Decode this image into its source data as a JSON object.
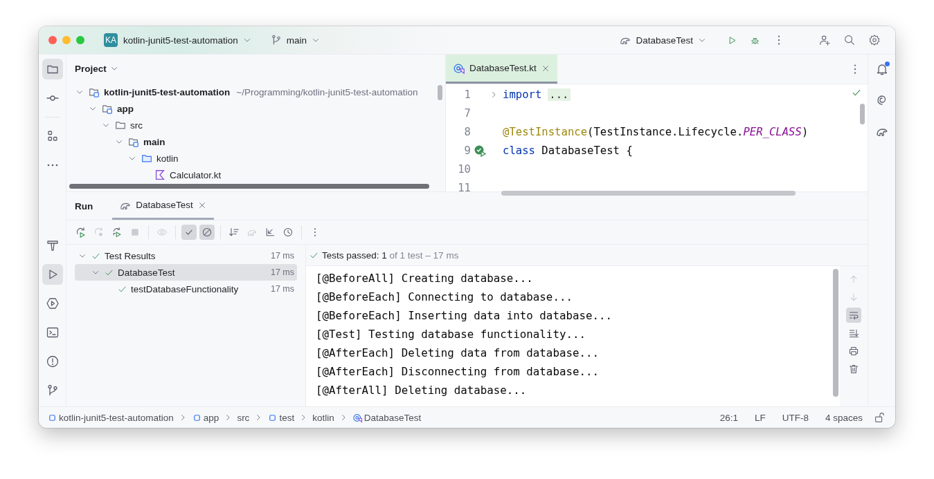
{
  "title_bar": {
    "project_badge": "KA",
    "project": "kotlin-junit5-test-automation",
    "branch": "main",
    "run_config": "DatabaseTest"
  },
  "left_stripe": {
    "top": [
      {
        "kind": "project",
        "selected": true
      },
      {
        "kind": "commit",
        "selected": false
      },
      {
        "kind": "structure",
        "selected": false
      },
      {
        "kind": "more",
        "selected": false
      }
    ],
    "bottom": [
      {
        "kind": "build",
        "selected": false
      },
      {
        "kind": "run",
        "selected": true
      },
      {
        "kind": "services",
        "selected": false
      },
      {
        "kind": "terminal",
        "selected": false
      },
      {
        "kind": "problems",
        "selected": false
      },
      {
        "kind": "git",
        "selected": false
      }
    ]
  },
  "right_stripe": [
    {
      "kind": "notifications",
      "badge": true
    },
    {
      "kind": "assistant",
      "badge": false
    },
    {
      "kind": "gradle",
      "badge": false
    }
  ],
  "project_panel": {
    "title": "Project",
    "tree": [
      {
        "name": "kotlin-junit5-test-automation",
        "kind": "module",
        "bold": true,
        "path": "~/Programming/kotlin-junit5-test-automation",
        "expanded": true,
        "children": [
          {
            "name": "app",
            "kind": "module",
            "bold": true,
            "expanded": true,
            "children": [
              {
                "name": "src",
                "kind": "folder",
                "bold": false,
                "expanded": true,
                "children": [
                  {
                    "name": "main",
                    "kind": "module",
                    "bold": true,
                    "expanded": true,
                    "children": [
                      {
                        "name": "kotlin",
                        "kind": "source_folder",
                        "bold": false,
                        "expanded": true,
                        "children": [
                          {
                            "name": "Calculator.kt",
                            "kind": "kotlin_file",
                            "bold": false
                          }
                        ]
                      }
                    ]
                  }
                ]
              }
            ]
          }
        ]
      }
    ]
  },
  "editor": {
    "tabs": [
      {
        "label": "DatabaseTest.kt",
        "selected": true
      }
    ],
    "lines": [
      {
        "number": "1",
        "folded": true,
        "run_gutter": false,
        "tokens": [
          {
            "text": "import",
            "kind": "keyword"
          },
          {
            "text": "...",
            "kind": "folded"
          }
        ]
      },
      {
        "number": "7",
        "folded": false,
        "run_gutter": false
      },
      {
        "number": "8",
        "folded": false,
        "run_gutter": false,
        "tokens": [
          {
            "text": "@TestInstance",
            "kind": "annotation"
          },
          {
            "text": "(TestInstance.Lifecycle.",
            "kind": "plain"
          },
          {
            "text": "PER_CLASS",
            "kind": "constant"
          },
          {
            "text": ")",
            "kind": "plain"
          }
        ]
      },
      {
        "number": "9",
        "folded": false,
        "run_gutter": true,
        "tokens": [
          {
            "text": "class",
            "kind": "keyword"
          },
          {
            "text": " DatabaseTest {",
            "kind": "plain"
          }
        ]
      },
      {
        "number": "10",
        "folded": false,
        "run_gutter": false
      },
      {
        "number": "11",
        "folded": false,
        "run_gutter": false
      }
    ]
  },
  "run_panel": {
    "title": "Run",
    "tabs": [
      {
        "label": "DatabaseTest",
        "selected": true
      }
    ],
    "toolbar": [
      {
        "kind": "rerun",
        "disabled": false,
        "on": false
      },
      {
        "kind": "rerun_failed",
        "disabled": true,
        "on": false
      },
      {
        "kind": "rerun_auto",
        "disabled": false,
        "on": false
      },
      {
        "kind": "stop",
        "disabled": true,
        "on": false
      },
      {
        "kind": "separator"
      },
      {
        "kind": "eye",
        "disabled": true,
        "on": false
      },
      {
        "kind": "separator"
      },
      {
        "kind": "show_passed",
        "disabled": false,
        "on": true
      },
      {
        "kind": "show_ignored",
        "disabled": false,
        "on": true
      },
      {
        "kind": "separator"
      },
      {
        "kind": "sort",
        "disabled": false,
        "on": false
      },
      {
        "kind": "gradle",
        "disabled": true,
        "on": false
      },
      {
        "kind": "collapse",
        "disabled": false,
        "on": false
      },
      {
        "kind": "history",
        "disabled": false,
        "on": false
      },
      {
        "kind": "separator"
      },
      {
        "kind": "more",
        "disabled": false,
        "on": false
      }
    ],
    "results": [
      {
        "name": "Test Results",
        "time": "17 ms",
        "expanded": true,
        "selected": false,
        "children": [
          {
            "name": "DatabaseTest",
            "time": "17 ms",
            "expanded": true,
            "selected": true,
            "children": [
              {
                "name": "testDatabaseFunctionality",
                "time": "17 ms",
                "selected": false
              }
            ]
          }
        ]
      }
    ],
    "summary": {
      "label": "Tests passed:",
      "count": "1",
      "detail": "of 1 test – 17 ms"
    },
    "console": [
      "[@BeforeAll] Creating database...",
      "[@BeforeEach] Connecting to database...",
      "[@BeforeEach] Inserting data into database...",
      "[@Test] Testing database functionality...",
      "[@AfterEach] Deleting data from database...",
      "[@AfterEach] Disconnecting from database...",
      "[@AfterAll] Deleting database..."
    ],
    "console_tools": [
      {
        "kind": "up",
        "disabled": true,
        "on": false
      },
      {
        "kind": "down",
        "disabled": true,
        "on": false
      },
      {
        "kind": "wrap",
        "disabled": false,
        "on": true
      },
      {
        "kind": "scroll_end",
        "disabled": false,
        "on": false
      },
      {
        "kind": "print",
        "disabled": false,
        "on": false
      },
      {
        "kind": "clear",
        "disabled": false,
        "on": false
      }
    ]
  },
  "status_bar": {
    "breadcrumbs": [
      {
        "label": "kotlin-junit5-test-automation",
        "kind": "module"
      },
      {
        "label": "app",
        "kind": "module"
      },
      {
        "label": "src",
        "kind": "folder"
      },
      {
        "label": "test",
        "kind": "module"
      },
      {
        "label": "kotlin",
        "kind": "folder"
      },
      {
        "label": "DatabaseTest",
        "kind": "class"
      }
    ],
    "items": [
      "26:1",
      "LF",
      "UTF-8",
      "4 spaces"
    ]
  }
}
